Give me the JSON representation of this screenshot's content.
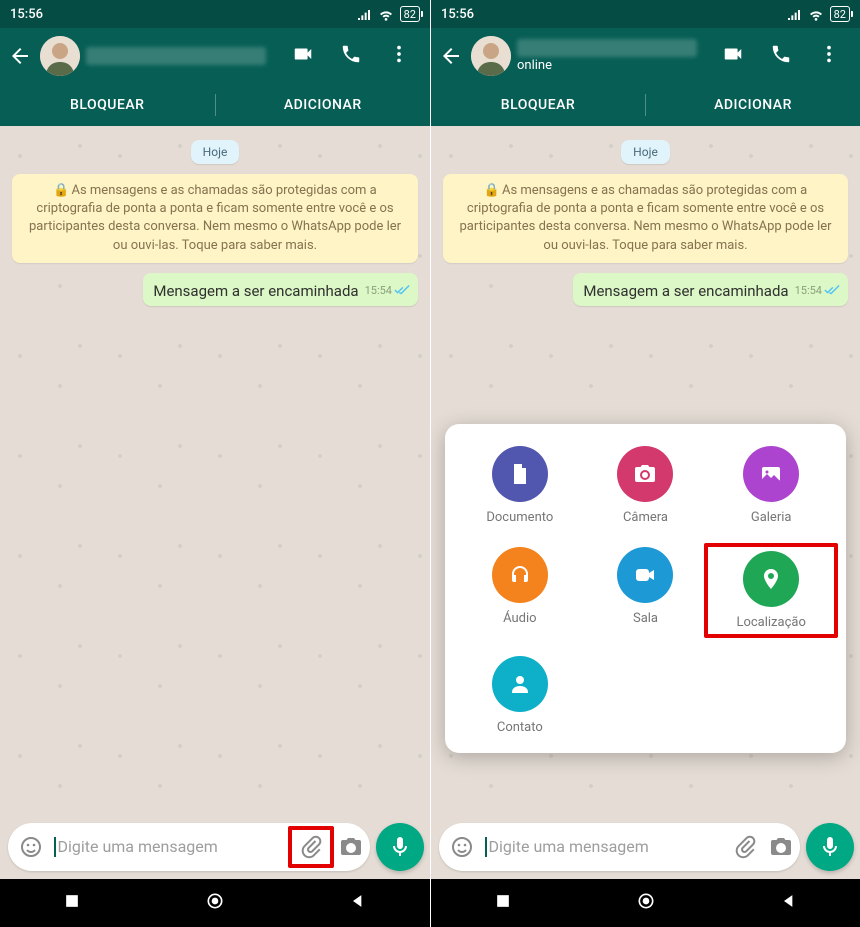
{
  "status": {
    "time": "15:56",
    "battery": "82"
  },
  "header": {
    "contact_status": "online",
    "block_label": "BLOQUEAR",
    "add_label": "ADICIONAR"
  },
  "chat": {
    "date_chip": "Hoje",
    "encryption_notice": "As mensagens e as chamadas são protegidas com a criptografia de ponta a ponta e ficam somente entre você e os participantes desta conversa. Nem mesmo o WhatsApp pode ler ou ouvi-las. Toque para saber mais.",
    "message_text": "Mensagem a ser encaminhada",
    "message_time": "15:54"
  },
  "input": {
    "placeholder": "Digite uma mensagem"
  },
  "attachments": {
    "document": {
      "label": "Documento",
      "color": "#5157ae"
    },
    "camera": {
      "label": "Câmera",
      "color": "#d3396d"
    },
    "gallery": {
      "label": "Galeria",
      "color": "#ac44cf"
    },
    "audio": {
      "label": "Áudio",
      "color": "#f5831d"
    },
    "room": {
      "label": "Sala",
      "color": "#1d9ad6"
    },
    "location": {
      "label": "Localização",
      "color": "#1fa755"
    },
    "contact": {
      "label": "Contato",
      "color": "#0eafc9"
    }
  }
}
